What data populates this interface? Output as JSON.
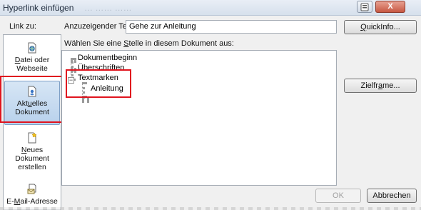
{
  "window": {
    "title": "Hyperlink einfügen",
    "ghost_title": "… …… ……",
    "help_icon": "help-icon",
    "close_symbol": "X"
  },
  "dialog": {
    "link_to_label": "Link zu:",
    "display_text_label_pre": "Anzuzeigender Te",
    "display_text_label_ul": "x",
    "display_text_label_post": "t:",
    "display_text_value": "Gehe zur Anleitung",
    "screentip_button_pre": "",
    "screentip_button_ul": "Q",
    "screentip_button_post": "uickInfo...",
    "select_place_label_pre": "Wählen Sie eine ",
    "select_place_label_ul": "S",
    "select_place_label_post": "telle in diesem Dokument aus:",
    "target_frame_button_pre": "Zielfr",
    "target_frame_button_ul": "a",
    "target_frame_button_post": "me...",
    "ok_button": "OK",
    "cancel_button": "Abbrechen"
  },
  "linkbar": {
    "items": [
      {
        "line1_pre": "",
        "line1_ul": "D",
        "line1_post": "atei oder",
        "line2": "Webseite",
        "icon": "globe-file-icon"
      },
      {
        "line1_pre": "Akt",
        "line1_ul": "u",
        "line1_post": "elles",
        "line2": "Dokument",
        "icon": "document-anchor-icon",
        "selected": true
      },
      {
        "line1_pre": "",
        "line1_ul": "N",
        "line1_post": "eues",
        "line2": "Dokument",
        "line3": "erstellen",
        "icon": "new-document-icon"
      },
      {
        "line1_pre": "E-",
        "line1_ul": "M",
        "line1_post": "ail-Adresse",
        "icon": "email-icon"
      }
    ]
  },
  "tree": {
    "nodes": [
      {
        "label": "Dokumentbeginn",
        "level": 0
      },
      {
        "label": "Überschriften",
        "level": 0
      },
      {
        "label": "Textmarken",
        "level": 0,
        "expanded": true,
        "expander": "−"
      },
      {
        "label": "Anleitung",
        "level": 1
      }
    ]
  },
  "colors": {
    "highlight_red": "#e0141e",
    "selection_blue": "#b8d1ec"
  }
}
